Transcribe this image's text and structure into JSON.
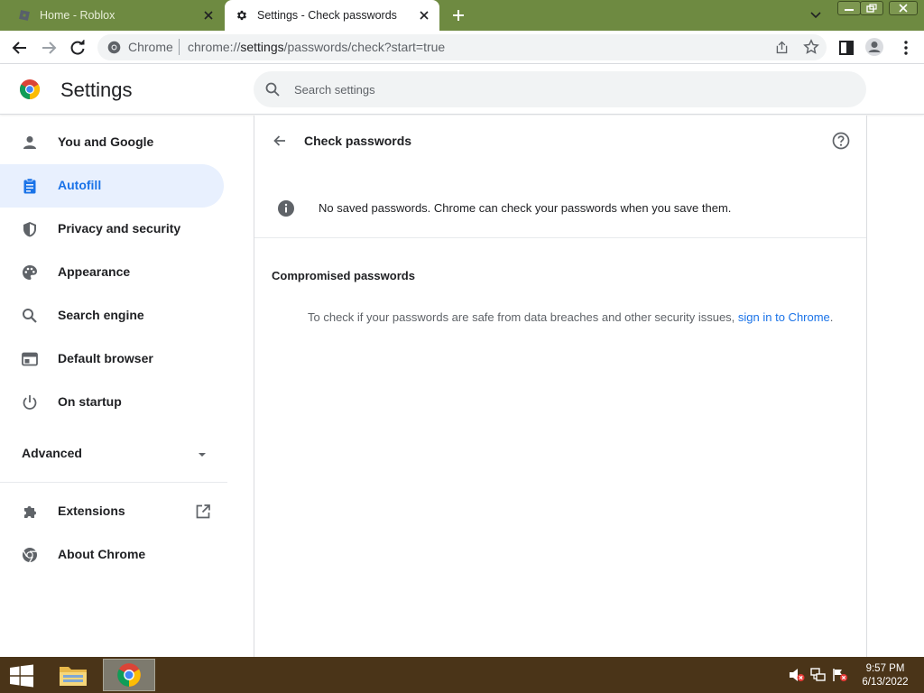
{
  "browser": {
    "tabs": [
      {
        "title": "Home - Roblox",
        "active": false
      },
      {
        "title": "Settings - Check passwords",
        "active": true
      }
    ],
    "omnibox": {
      "site_label": "Chrome",
      "url_prefix": "chrome://",
      "url_host": "settings",
      "url_path": "/passwords/check?start=true"
    }
  },
  "settings": {
    "title": "Settings",
    "search_placeholder": "Search settings",
    "nav": [
      {
        "label": "You and Google",
        "icon": "person-icon",
        "active": false
      },
      {
        "label": "Autofill",
        "icon": "clipboard-icon",
        "active": true
      },
      {
        "label": "Privacy and security",
        "icon": "shield-icon",
        "active": false
      },
      {
        "label": "Appearance",
        "icon": "palette-icon",
        "active": false
      },
      {
        "label": "Search engine",
        "icon": "search-icon",
        "active": false
      },
      {
        "label": "Default browser",
        "icon": "browser-icon",
        "active": false
      },
      {
        "label": "On startup",
        "icon": "power-icon",
        "active": false
      }
    ],
    "advanced_label": "Advanced",
    "extensions_label": "Extensions",
    "about_label": "About Chrome"
  },
  "page": {
    "title": "Check passwords",
    "info_message": "No saved passwords. Chrome can check your passwords when you save them.",
    "section_title": "Compromised passwords",
    "section_text": "To check if your passwords are safe from data breaches and other security issues, ",
    "section_link": "sign in to Chrome",
    "section_text_end": "."
  },
  "taskbar": {
    "time": "9:57 PM",
    "date": "6/13/2022"
  },
  "colors": {
    "tabstrip": "#6e8a41",
    "accent": "#1a73e8",
    "taskbar": "#4a3418"
  }
}
